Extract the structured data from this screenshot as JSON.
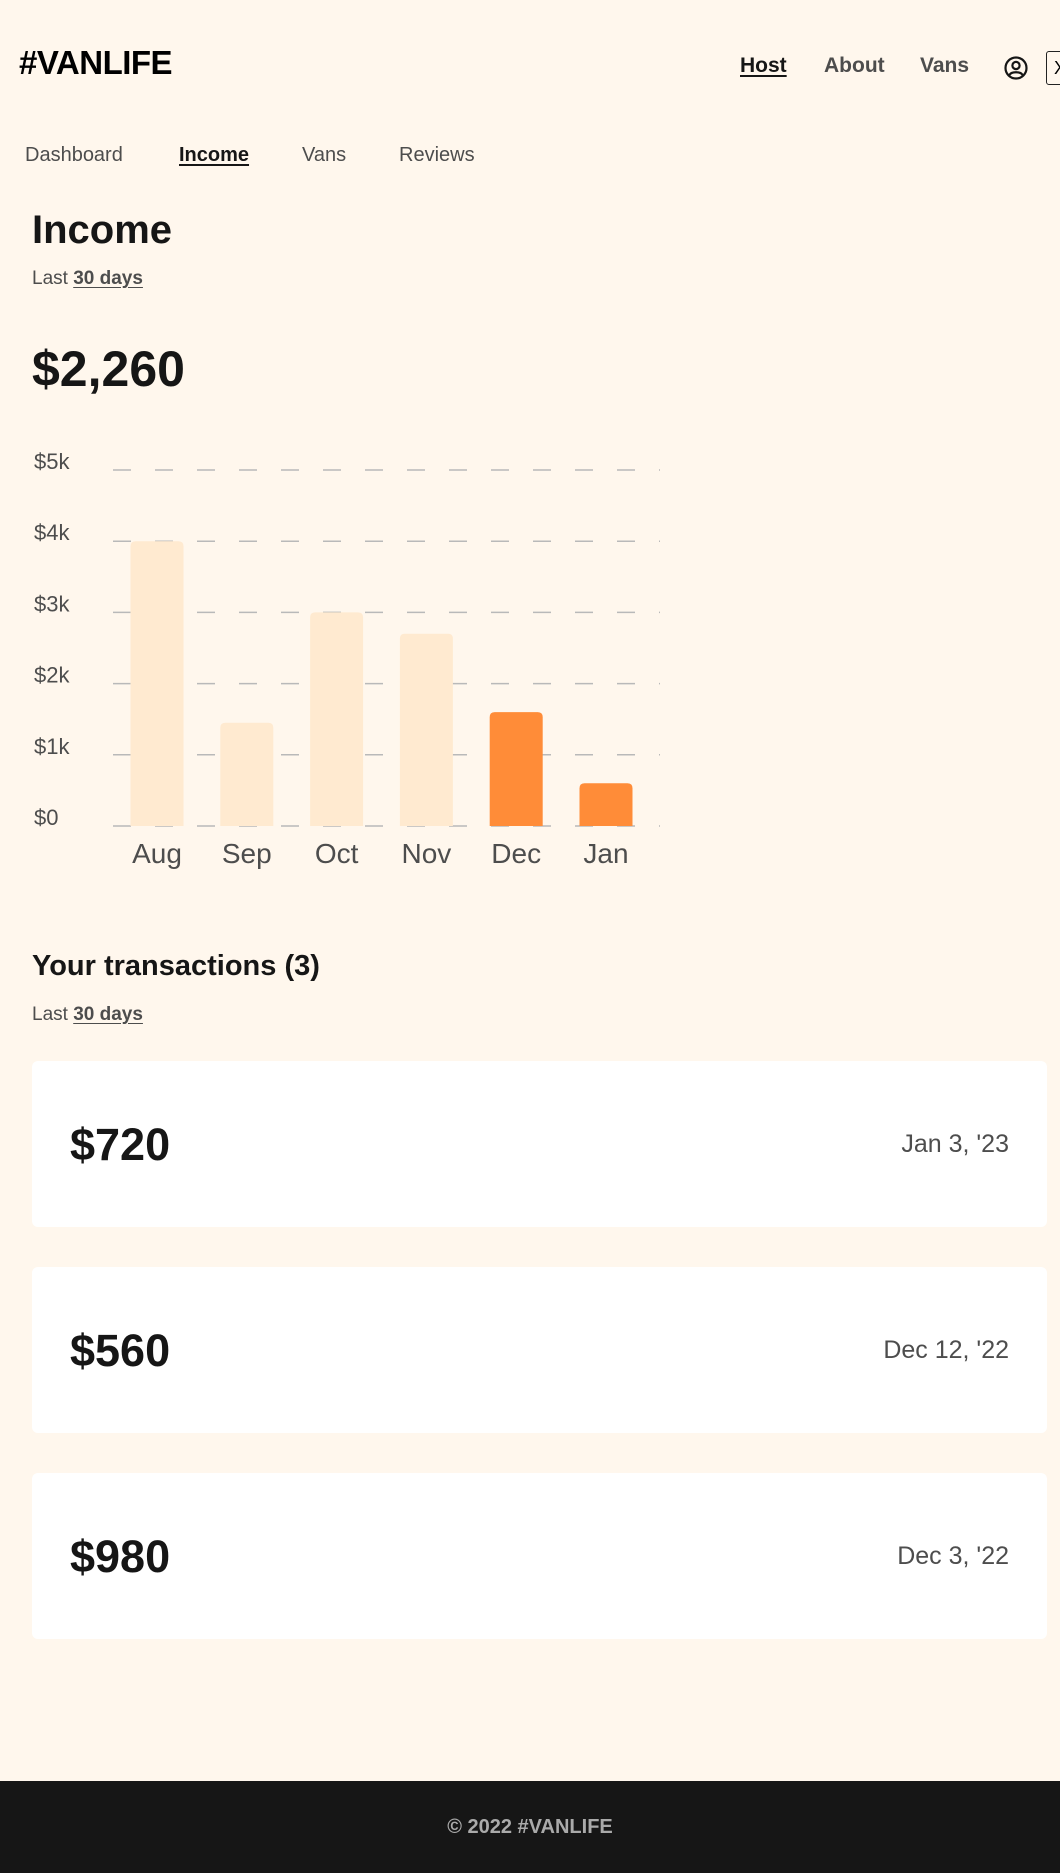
{
  "brand": {
    "logo_text": "#VANLIFE"
  },
  "top_nav": {
    "links": [
      "Host",
      "About",
      "Vans"
    ],
    "active": "Host",
    "avatar_icon": "user-circle-icon",
    "logout_label": "X"
  },
  "sub_nav": {
    "links": [
      "Dashboard",
      "Income",
      "Vans",
      "Reviews"
    ],
    "active": "Income"
  },
  "income": {
    "title": "Income",
    "period_prefix": "Last",
    "period_link": "30 days",
    "total": "$2,260"
  },
  "chart_data": {
    "type": "bar",
    "categories": [
      "Aug",
      "Sep",
      "Oct",
      "Nov",
      "Dec",
      "Jan"
    ],
    "values": [
      4000,
      1450,
      3000,
      2700,
      1600,
      600
    ],
    "y_ticks": [
      "$0",
      "$1k",
      "$2k",
      "$3k",
      "$4k",
      "$5k"
    ],
    "ylim": [
      0,
      5000
    ],
    "grid": "dashed",
    "highlighted": [
      "Dec",
      "Jan"
    ],
    "colors": {
      "bar": "#FFEAD0",
      "highlight": "#FF8C38",
      "grid": "#B9B9B9",
      "tick_text": "#4D4D4D"
    }
  },
  "transactions": {
    "title": "Your transactions (3)",
    "period_prefix": "Last",
    "period_link": "30 days",
    "items": [
      {
        "amount": "$720",
        "date": "Jan 3, '23"
      },
      {
        "amount": "$560",
        "date": "Dec 12, '22"
      },
      {
        "amount": "$980",
        "date": "Dec 3, '22"
      }
    ]
  },
  "footer": {
    "text": "© 2022 #VANLIFE"
  },
  "colors": {
    "background": "#FFF7ED",
    "accent": "#FF8C38",
    "card": "#FFFFFF",
    "footer_bg": "#161616"
  }
}
